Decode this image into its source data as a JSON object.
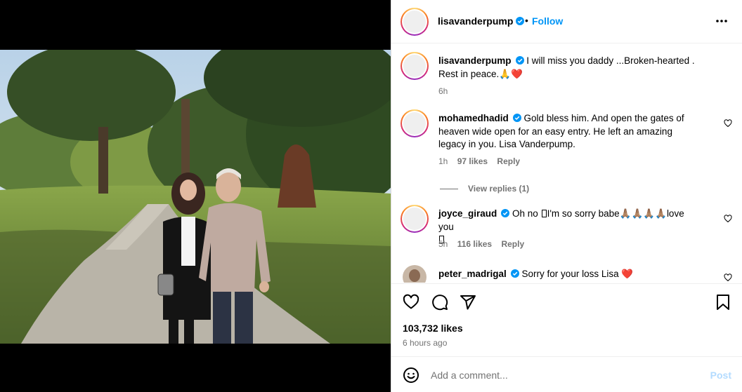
{
  "post": {
    "author": "lisavanderpump",
    "follow_label": "Follow",
    "separator": "•",
    "photo_alt": "Two people standing on a park path under large trees"
  },
  "comments": [
    {
      "username": "lisavanderpump",
      "text": " I will miss you daddy ...Broken-hearted . Rest in peace.",
      "emojis": "🙏❤️",
      "time": "6h"
    },
    {
      "username": "mohamedhadid",
      "text": " Gold bless him. And open the gates of heaven wide open for an easy entry. He left an amazing legacy in you. Lisa Vanderpump.",
      "time": "1h",
      "likes": "97 likes",
      "reply": "Reply",
      "view_replies": "View replies (1)"
    },
    {
      "username": "joyce_giraud",
      "text_a": " Oh no ",
      "text_b": "I'm so sorry babe",
      "emojis": "🙏🏽🙏🏽🙏🏽🙏🏽",
      "text_c": "love you",
      "time": "5h",
      "likes": "116 likes",
      "reply": "Reply"
    },
    {
      "username": "peter_madrigal",
      "text": " Sorry for your loss Lisa",
      "emojis": "❤️"
    }
  ],
  "stats": {
    "likes": "103,732 likes",
    "time_ago": "6 hours ago"
  },
  "composer": {
    "placeholder": "Add a comment...",
    "post_label": "Post"
  },
  "colors": {
    "accent": "#0095f6",
    "muted": "#737373",
    "post_disabled": "#b3dbff",
    "verified": "#0095f6"
  }
}
